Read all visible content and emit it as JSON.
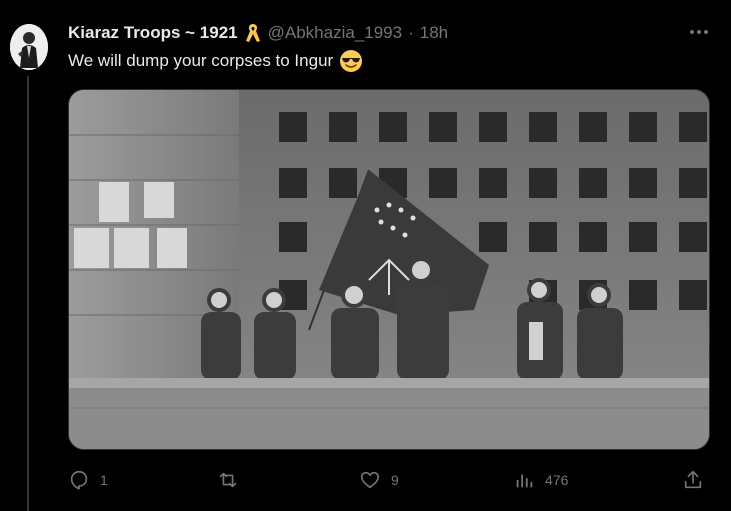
{
  "tweet": {
    "display_name": "Kiaraz Troops ~ 1921",
    "handle": "@Abkhazia_1993",
    "separator": "·",
    "time": "18h",
    "text": "We will dump your corpses to Ingur",
    "emoji": "smiling-face-with-sunglasses",
    "badge_icon": "yellow-ribbon-icon"
  },
  "media": {
    "alt": "Black and white photo of armed men holding a flag in front of a burned government building"
  },
  "actions": {
    "reply_count": "1",
    "retweet_count": "",
    "like_count": "9",
    "view_count": "476"
  },
  "colors": {
    "background": "#000000",
    "text": "#e7e9ea",
    "muted": "#71767b",
    "ribbon": "#ffc83d"
  }
}
